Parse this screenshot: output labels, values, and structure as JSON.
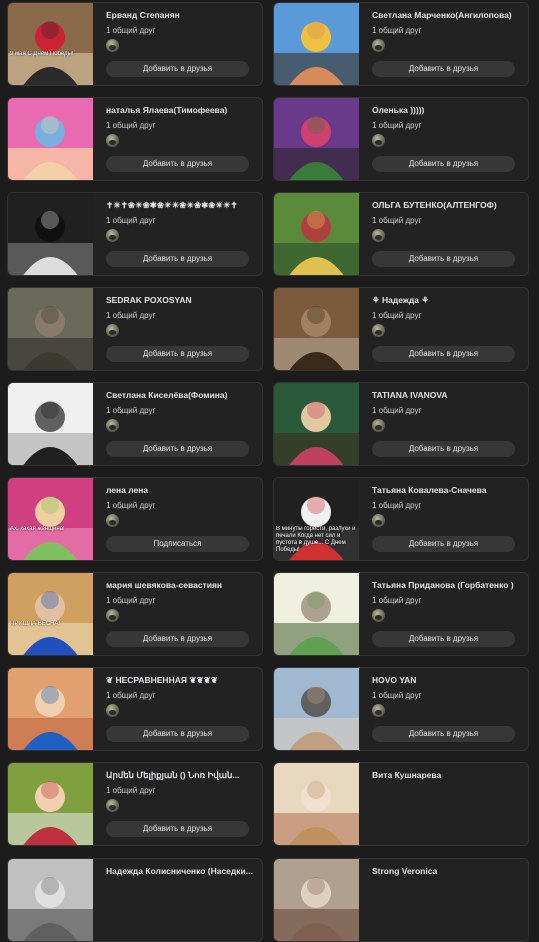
{
  "cards": [
    {
      "name": "Ерванд Степанян",
      "mutual": "1 общий друг",
      "button": "Добавить в друзья",
      "photo_caption": "9 мая С Днем Победы!"
    },
    {
      "name": "Светлана Марченко(Ангилопова)",
      "mutual": "1 общий друг",
      "button": "Добавить в друзья"
    },
    {
      "name": "наталья Ялаева(Тимофеева)",
      "mutual": "1 общий друг",
      "button": "Добавить в друзья"
    },
    {
      "name": "Оленька )))))",
      "mutual": "1 общий друг",
      "button": "Добавить в друзья"
    },
    {
      "name": "✝☀✝❀☀❀✱❀☀☀❀☀❀✱❀☀☀✝",
      "mutual": "1 общий друг",
      "button": "Добавить в друзья"
    },
    {
      "name": "ОЛЬГА БУТЕНКО(АЛТЕНГОФ)",
      "mutual": "1 общий друг",
      "button": "Добавить в друзья"
    },
    {
      "name": "SEDRAK POXOSYAN",
      "mutual": "1 общий друг",
      "button": "Добавить в друзья"
    },
    {
      "name": "⚘ Надежда ⚘",
      "mutual": "1 общий друг",
      "button": "Добавить в друзья"
    },
    {
      "name": "Светлана Киселёва(Фомина)",
      "mutual": "1 общий друг",
      "button": "Добавить в друзья"
    },
    {
      "name": "TATIANA IVANOVA",
      "mutual": "1 общий друг",
      "button": "Добавить в друзья"
    },
    {
      "name": "лена лена",
      "mutual": "1 общий друг",
      "button": "Подписаться",
      "photo_caption": "Ах, какая женщина!"
    },
    {
      "name": "Татьяна Ковалева-Сначева",
      "mutual": "1 общий друг",
      "button": "Добавить в друзья",
      "photo_caption": "В минуты горести, разлуки и печали Когда нет сил и пустота в душе... С Днем Победы!"
    },
    {
      "name": "мария шевякова-севастиян",
      "mutual": "1 общий друг",
      "button": "Добавить в друзья",
      "photo_caption": "ПРИШЛА ВЕСНА!"
    },
    {
      "name": "Татьяна Приданова (Горбатенко )",
      "mutual": "1 общий друг",
      "button": "Добавить в друзья"
    },
    {
      "name": "❦ НЕСРАВНЕННАЯ ❦❦❦❦",
      "mutual": "1 общий друг",
      "button": "Добавить в друзья"
    },
    {
      "name": "HOVO YAN",
      "mutual": "1 общий друг",
      "button": "Добавить в друзья"
    },
    {
      "name": "Արմեն Մելիքյան () Նոռ Իվան...",
      "mutual": "1 общий друг",
      "button": "Добавить в друзья"
    },
    {
      "name": "Вита Кушнарева",
      "mutual": "",
      "button": ""
    },
    {
      "name": "Надежда Колисниченко (Наседки...",
      "mutual": "",
      "button": ""
    },
    {
      "name": "Strong Veronica",
      "mutual": "",
      "button": ""
    }
  ]
}
